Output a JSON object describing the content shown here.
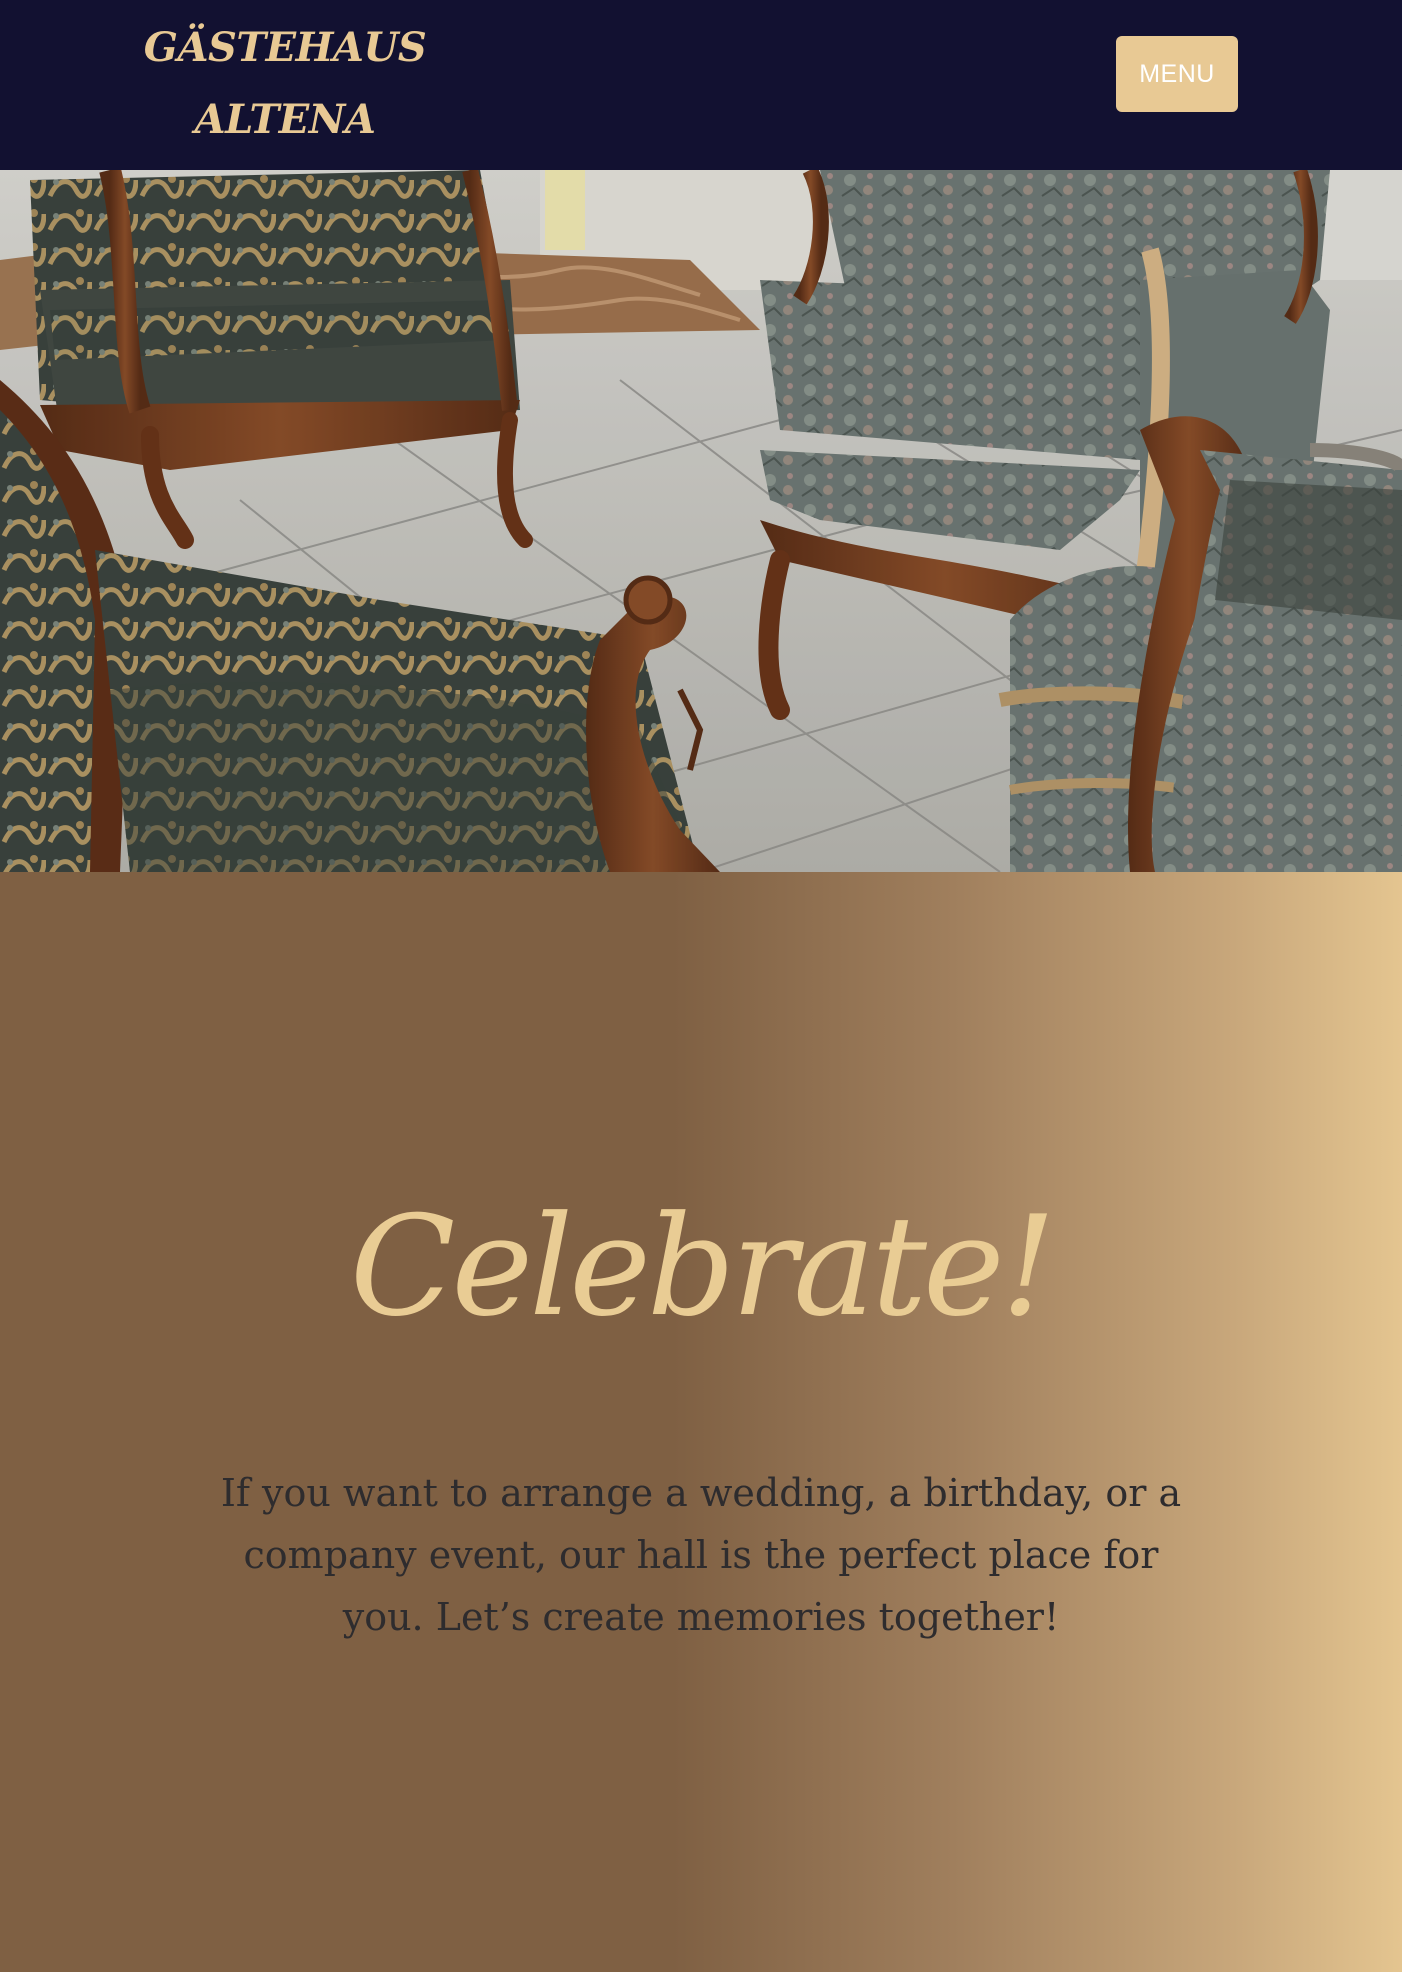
{
  "header": {
    "logo_line1": "GÄSTEHAUS",
    "logo_line2": "ALTENA",
    "menu_label": "MENU"
  },
  "celebrate": {
    "title": "Celebrate!",
    "text": "If you want to arrange a wedding, a birthday, or a company event, our hall is the perfect place for you. Let’s create memories together!"
  },
  "colors": {
    "header_bg": "#121131",
    "accent_gold": "#e8c994",
    "section_brown": "#7f6043",
    "body_text": "#2e2c2e"
  }
}
